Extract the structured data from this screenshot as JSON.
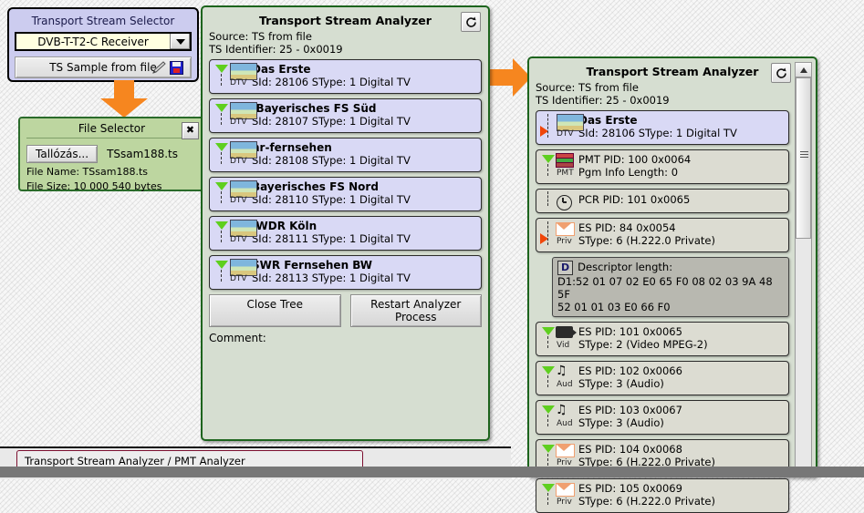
{
  "selector": {
    "title": "Transport Stream Selector",
    "combo_value": "DVB-T-T2-C Receiver",
    "combo_icon": "chevron-down-icon",
    "sample_button": "TS Sample from file",
    "sample_icons": [
      "pencil-icon",
      "floppy-disk-icon"
    ]
  },
  "file_selector": {
    "title": "File Selector",
    "close_label": "✖",
    "browse_label": "Tallózás...",
    "selected_file": "TSsam188.ts",
    "file_name_line": "File Name: TSsam188.ts",
    "file_size_line": "File Size: 10 000 540 bytes"
  },
  "middle_panel": {
    "title": "Transport Stream Analyzer",
    "refresh_icon": "refresh-icon",
    "source": "Source: TS from file",
    "ts_identifier": "TS Identifier: 25 - 0x0019",
    "services": [
      {
        "name": "Das Erste",
        "info": "SId: 28106 SType: 1 Digital TV",
        "kind": "DTV"
      },
      {
        "name": ".Bayerisches FS Süd",
        "info": "SId: 28107 SType: 1 Digital TV",
        "kind": "DTV"
      },
      {
        "name": "hr-fernsehen",
        "info": "SId: 28108 SType: 1 Digital TV",
        "kind": "DTV"
      },
      {
        "name": "Bayerisches FS Nord",
        "info": "SId: 28110 SType: 1 Digital TV",
        "kind": "DTV"
      },
      {
        "name": ".WDR Köln",
        "info": "SId: 28111 SType: 1 Digital TV",
        "kind": "DTV"
      },
      {
        "name": "SWR Fernsehen BW",
        "info": "SId: 28113 SType: 1 Digital TV",
        "kind": "DTV"
      }
    ],
    "close_tree_button": "Close Tree",
    "restart_button": "Restart Analyzer Process",
    "comment_label": "Comment:"
  },
  "right_panel": {
    "title": "Transport Stream Analyzer",
    "refresh_icon": "refresh-icon",
    "source": "Source: TS from file",
    "ts_identifier": "TS Identifier: 25 - 0x0019",
    "service": {
      "name": "Das Erste",
      "info": "SId: 28106 SType: 1 Digital TV",
      "kind": "DTV"
    },
    "pmt": {
      "line1": "PMT PID: 100 0x0064",
      "line2": "Pgm Info Length: 0",
      "kind": "PMT",
      "icon": "books-icon"
    },
    "pcr": {
      "line1": "PCR PID: 101 0x0065",
      "icon": "clock-icon"
    },
    "es_private_top": {
      "line1": "ES PID: 84 0x0054",
      "line2": "SType: 6 (H.222.0 Private)",
      "kind": "Priv",
      "icon": "envelope-icon"
    },
    "descriptor": {
      "badge": "D",
      "label": "Descriptor length:",
      "hex_line1": "D1:52 01 07 02 E0 65 F0 08 02 03 9A 48 5F",
      "hex_line2": "52 01 01 03 E0 66 F0"
    },
    "elementary_streams": [
      {
        "line1": "ES PID: 101 0x0065",
        "line2": "SType: 2 (Video MPEG-2)",
        "kind": "Vid",
        "icon": "video-camera-icon"
      },
      {
        "line1": "ES PID: 102 0x0066",
        "line2": "SType: 3 (Audio)",
        "kind": "Aud",
        "icon": "music-note-icon"
      },
      {
        "line1": "ES PID: 103 0x0067",
        "line2": "SType: 3 (Audio)",
        "kind": "Aud",
        "icon": "music-note-icon"
      },
      {
        "line1": "ES PID: 104 0x0068",
        "line2": "SType: 6 (H.222.0 Private)",
        "kind": "Priv",
        "icon": "envelope-icon"
      },
      {
        "line1": "ES PID: 105 0x0069",
        "line2": "SType: 6 (H.222.0 Private)",
        "kind": "Priv",
        "icon": "envelope-icon"
      }
    ],
    "scrollbar": {
      "up_icon": "scroll-up-arrow-icon"
    }
  },
  "status_bar": {
    "text": "Transport Stream Analyzer / PMT Analyzer"
  },
  "arrows": {
    "down": "orange-arrow-down-icon",
    "right": "orange-arrow-right-icon"
  },
  "colors": {
    "accent_orange": "#f6861f",
    "panel_green_border": "#1d641d",
    "panel_green_bg": "#d6ded1",
    "selector_bg": "#ccccef",
    "file_selector_bg": "#bdd6a0",
    "status_border": "#7d1030"
  }
}
